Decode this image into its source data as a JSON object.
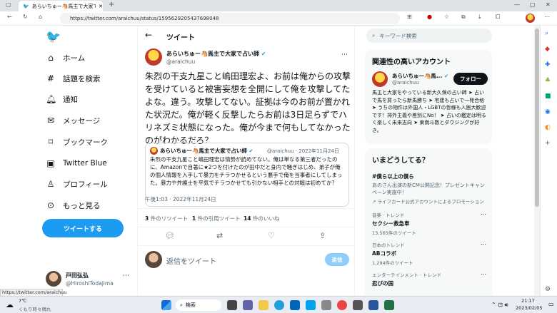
{
  "browser": {
    "tab_title": "あらいちゅー🐴馬主で大家で占い師",
    "url": "https://twitter.com/araichuu/status/1595629205437698048",
    "status_url": "https://twitter.com/araichuu"
  },
  "nav": {
    "home": "ホーム",
    "explore": "話題を検索",
    "notifications": "通知",
    "messages": "メッセージ",
    "bookmarks": "ブックマーク",
    "twitter_blue": "Twitter Blue",
    "profile": "プロフィール",
    "more": "もっと見る",
    "tweet_button": "ツイートする",
    "account_name": "戸田弘弘",
    "account_handle": "@HiroshiTodajima"
  },
  "main": {
    "header": "ツイート",
    "author_name": "あらいちゅー🐴馬主で大家で占い師",
    "author_handle": "@araichuu",
    "tweet_text": "朱烈の干支九星こと嶋田理宏よ、お前は俺からの攻撃を受けていると被害妄想を全開にして俺を攻撃してたよな。違う。攻撃してない。証拠は今のお前が置かれた状況だ。俺が軽く反撃したらお前は3日足らずでハリネズミ状態になった。俺が今まで何もしてなかったのがわかるだろ？",
    "quote_author": "あらいちゅー🐴馬主で大家で占い師",
    "quote_handle": "@araichuu · 2022年11月24日",
    "quote_text": "朱烈の干支九星こと嶋田理宏は情勢が読めてない。俺は単なる第三者だったのに、Amazonで自著に★2つを付けたのが田中だと身内で騒ぎはじめ、弟子が俺の個人情報を入手して暴力をチラつかせるという悪手で俺を当事者にしてしまった。暴力や弁護士を平気でチラつかせても引かない相手との対戦は初めてか？",
    "timestamp": "午後1:03 · 2022年11月24日",
    "retweets_count": "3",
    "retweets_label": "件のリツイート",
    "quotes_count": "1",
    "quotes_label": "件の引用ツイート",
    "likes_count": "14",
    "likes_label": "件のいいね",
    "reply_placeholder": "返信をツイート",
    "reply_button": "返信"
  },
  "right": {
    "search_placeholder": "キーワード検索",
    "related_title": "関連性の高いアカウント",
    "related_name": "あらいちゅー🐴馬...",
    "related_handle": "@araichuu",
    "follow_button": "フォロー",
    "related_bio": "馬主と大家をやっている新大久保の占い師 ➤ 占いで馬を買ったら新馬勝ち ➤ 宅建も占いで一発合格 ➤ うちの物件は外国人・LGBTの皆様も入居大歓迎です！排外主義や差別にNo！ ➤ 占いの鑑定は明るく楽しく未来志向 ➤ 東南斗数とダウジングが好き。",
    "trends_title": "いまどうしてる？",
    "trends": [
      {
        "title": "#僕ら以上の僕ら",
        "desc": "あのさん出演の新CM公開記念！プレゼントキャンペーン実施中！",
        "promo": "ライフカード公式アカウントによるプロモーション"
      },
      {
        "category": "音楽 · トレンド",
        "title": "セクシー救急車",
        "count": "13,565件のツイート"
      },
      {
        "category": "日本のトレンド",
        "title": "ABコラボ",
        "count": "1,294件のツイート"
      },
      {
        "category": "エンターテインメント · トレンド",
        "title": "忍びの国"
      }
    ]
  },
  "taskbar": {
    "weather_temp": "7℃",
    "weather_desc": "くもり時々晴れ",
    "search_label": "検索",
    "time": "21:17",
    "date": "2023/02/05"
  },
  "colors": {
    "accent": "#1d9bf0",
    "verified": "#1d9bf0"
  }
}
